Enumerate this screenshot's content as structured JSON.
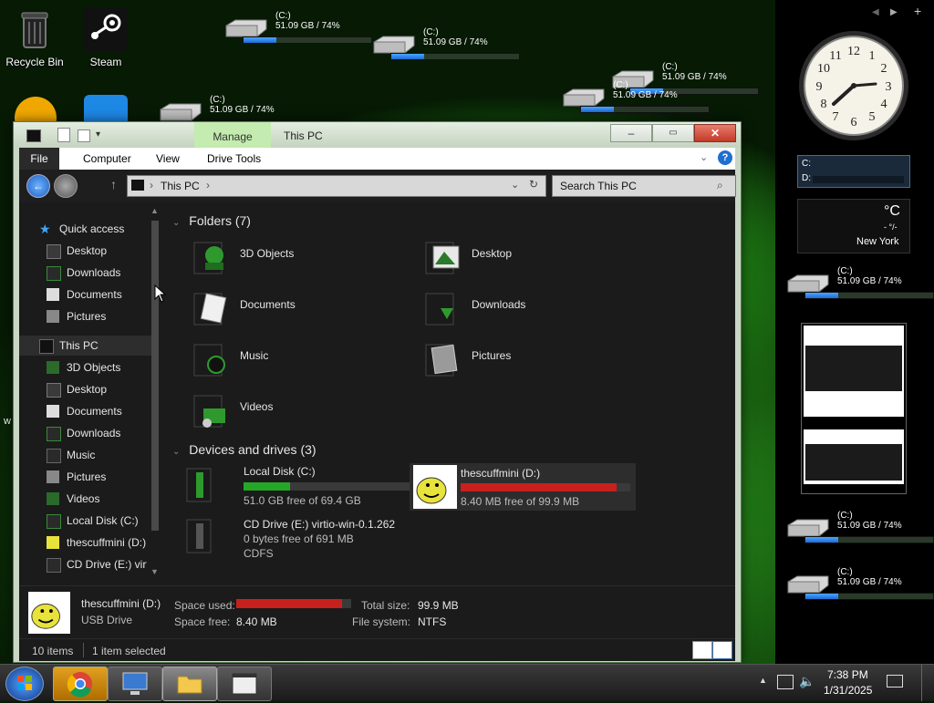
{
  "desktop": {
    "icons": [
      {
        "label": "Recycle Bin",
        "icon": "recycle-bin-icon"
      },
      {
        "label": "Steam",
        "icon": "steam-icon"
      }
    ],
    "stray_char": "w"
  },
  "drive_gadget": {
    "title": "(C:)",
    "value": "51.09 GB / 74%",
    "percent": 74
  },
  "window": {
    "title": "This PC",
    "context_tab": "Manage",
    "controls": {
      "minimize": "minimize",
      "maximize": "maximize",
      "close": "close"
    },
    "ribbon_tabs": [
      "File",
      "Computer",
      "View",
      "Drive Tools"
    ],
    "address": {
      "location": "This PC",
      "search_placeholder": "Search This PC"
    },
    "nav": {
      "quick_access": "Quick access",
      "quick_items": [
        "Desktop",
        "Downloads",
        "Documents",
        "Pictures"
      ],
      "this_pc": "This PC",
      "pc_items": [
        "3D Objects",
        "Desktop",
        "Documents",
        "Downloads",
        "Music",
        "Pictures",
        "Videos",
        "Local Disk (C:)",
        "thescuffmini (D:)",
        "CD Drive (E:) virt"
      ]
    },
    "folders_header": "Folders (7)",
    "folders": [
      "3D Objects",
      "Desktop",
      "Documents",
      "Downloads",
      "Music",
      "Pictures",
      "Videos"
    ],
    "devices_header": "Devices and drives (3)",
    "drives": [
      {
        "name": "Local Disk (C:)",
        "free": "51.0 GB free of 69.4 GB",
        "used_fraction": 0.27,
        "color": "#26a626"
      },
      {
        "name": "thescuffmini (D:)",
        "free": "8.40 MB free of 99.9 MB",
        "used_fraction": 0.92,
        "color": "#c8201c"
      },
      {
        "name": "CD Drive (E:) virtio-win-0.1.262",
        "free": "0 bytes free of 691 MB",
        "fs": "CDFS"
      }
    ],
    "details": {
      "name": "thescuffmini (D:)",
      "type": "USB Drive",
      "space_used_label": "Space used:",
      "space_free_label": "Space free:",
      "space_free": "8.40 MB",
      "total_size_label": "Total size:",
      "total_size": "99.9 MB",
      "file_system_label": "File system:",
      "file_system": "NTFS",
      "used_fraction": 0.92
    },
    "status": {
      "items": "10 items",
      "selected": "1 item selected"
    }
  },
  "sidebar": {
    "clock_numbers": [
      "12",
      "1",
      "2",
      "3",
      "4",
      "5",
      "6",
      "7",
      "8",
      "9",
      "10",
      "11"
    ],
    "cpu_labels": [
      "C:",
      "D:"
    ],
    "weather": {
      "temp": "°C",
      "sub": "- °/-",
      "city": "New York"
    }
  },
  "taskbar": {
    "time": "7:38 PM",
    "date": "1/31/2025"
  },
  "colors": {
    "accent": "#3fa5ff",
    "used_red": "#c8201c",
    "used_green": "#26a626"
  }
}
